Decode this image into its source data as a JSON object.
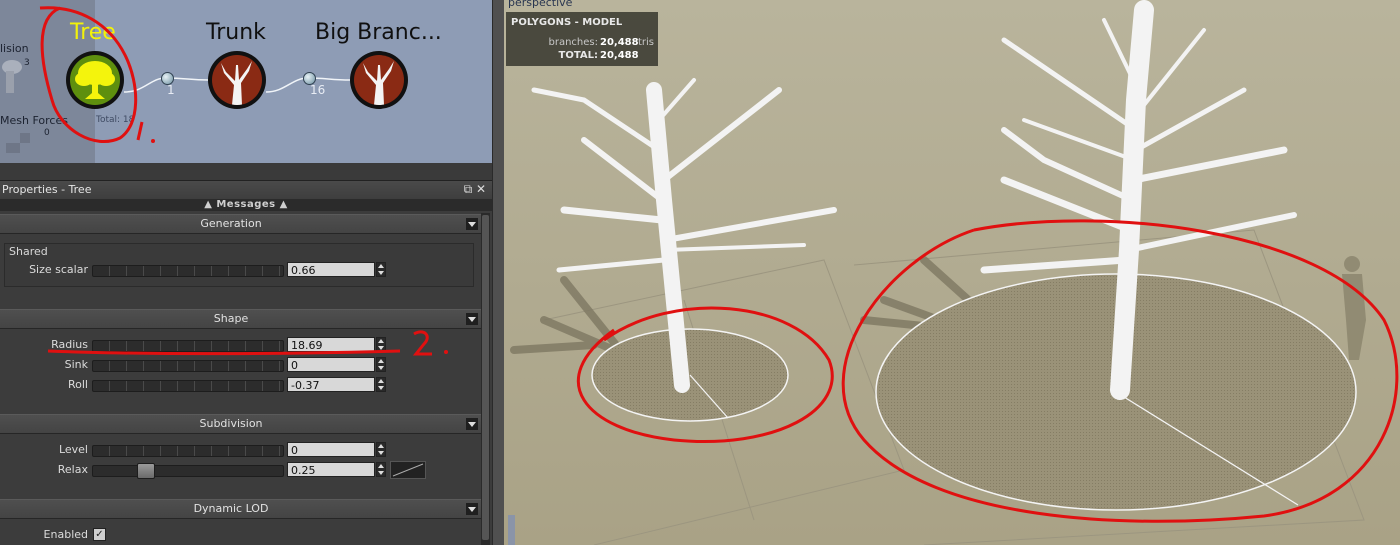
{
  "graph": {
    "left_labels": {
      "collision": "lision",
      "collision_count": "3",
      "mesh_forces": "Mesh Forces",
      "mesh_forces_count": "0"
    },
    "nodes": [
      {
        "title": "Tree",
        "title_color": "#f2f20a",
        "icon": "tree-icon",
        "total": "Total: 18"
      },
      {
        "title": "Trunk",
        "icon": "branch-icon",
        "count": "1"
      },
      {
        "title": "Big Branc...",
        "icon": "branch-icon",
        "count": "16"
      }
    ]
  },
  "properties": {
    "title": "Properties - Tree",
    "header_buttons": "⧉ ✕",
    "messages": "Messages",
    "sections": {
      "generation": "Generation",
      "shape": "Shape",
      "subdivision": "Subdivision",
      "dynamic_lod": "Dynamic LOD"
    },
    "shared_group": "Shared",
    "rows": {
      "size_scalar": {
        "label": "Size scalar",
        "value": "0.66"
      },
      "radius": {
        "label": "Radius",
        "value": "18.69"
      },
      "sink": {
        "label": "Sink",
        "value": "0"
      },
      "roll": {
        "label": "Roll",
        "value": "-0.37"
      },
      "level": {
        "label": "Level",
        "value": "0"
      },
      "relax": {
        "label": "Relax",
        "value": "0.25",
        "slider_fraction": 0.25
      },
      "enabled": {
        "label": "Enabled",
        "checked": true,
        "check_glyph": "✓"
      }
    }
  },
  "viewport": {
    "label": "perspective",
    "stats": {
      "heading": "POLYGONS - MODEL",
      "branches_label": "branches:",
      "branches_value": "20,488",
      "branches_unit": "tris",
      "total_label": "TOTAL:",
      "total_value": "20,488"
    }
  },
  "annotations": {
    "color": "#e01010",
    "mark_1": "1.",
    "mark_2": "2."
  }
}
